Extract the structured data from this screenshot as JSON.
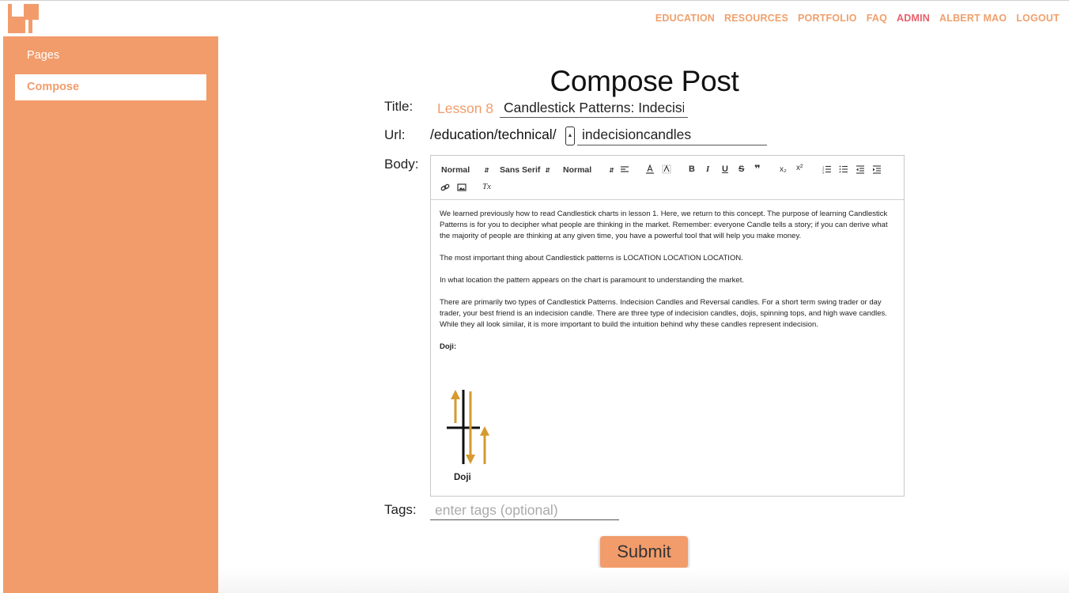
{
  "colors": {
    "accent": "#f29c6b",
    "active_nav": "#e8606a",
    "nav": "#f0a06c"
  },
  "topnav": {
    "items": [
      {
        "label": "EDUCATION",
        "icon": ""
      },
      {
        "label": "RESOURCES"
      },
      {
        "label": "PORTFOLIO"
      },
      {
        "label": "FAQ"
      },
      {
        "label": "ADMIN",
        "active": true
      },
      {
        "label": "ALBERT MAO"
      },
      {
        "label": "LOGOUT"
      }
    ]
  },
  "sidebar": {
    "items": [
      {
        "label": "Pages"
      },
      {
        "label": "Compose",
        "selected": true
      }
    ]
  },
  "form": {
    "heading": "Compose Post",
    "title_label": "Title:",
    "lesson_prefix": "Lesson 8",
    "title_value": "Candlestick Patterns: Indecision Candles",
    "url_label": "Url:",
    "url_prefix": "/education/technical/",
    "url_value": "indecisioncandles",
    "body_label": "Body:",
    "tags_label": "Tags:",
    "tags_placeholder": "enter tags (optional)",
    "submit_label": "Submit"
  },
  "editor": {
    "toolbar": {
      "header_select": "Normal",
      "font_select": "Sans Serif",
      "size_select": "Normal",
      "bold": "B",
      "italic": "I",
      "underline": "U",
      "strike": "S",
      "quote": "❞",
      "subscript": "x₂",
      "superscript": "x²",
      "clean": "Tx"
    },
    "paragraphs": [
      "We learned previously how to read Candlestick charts in lesson 1. Here, we return to this concept. The purpose of learning Candlestick Patterns is for you to decipher what people are thinking in the market. Remember: everyone Candle tells a story; if you can derive what the majority of people are thinking at any given time, you have a powerful tool that will help you make money.",
      "The most important thing about Candlestick patterns is LOCATION LOCATION LOCATION.",
      "In what location the pattern appears on the chart is paramount to understanding the market.",
      "There are primarily two types of Candlestick Patterns. Indecision Candles and Reversal candles. For a short term swing trader or day trader, your best friend is an indecision candle. There are three type of indecision candles, dojis, spinning tops, and high wave candles. While they all look similar, it is more important to build the intuition behind why these candles represent indecision."
    ],
    "doji_heading": "Doji:",
    "doji_caption": "Doji"
  }
}
